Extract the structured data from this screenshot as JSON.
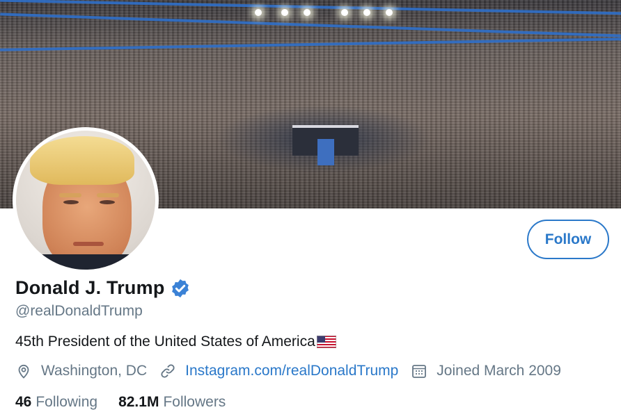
{
  "profile": {
    "name": "Donald J. Trump",
    "handle": "@realDonaldTrump",
    "bio": "45th President of the United States of America",
    "location": "Washington, DC",
    "website": "Instagram.com/realDonaldTrump",
    "joined": "Joined March 2009"
  },
  "actions": {
    "follow_label": "Follow"
  },
  "stats": {
    "following_count": "46",
    "following_label": "Following",
    "followers_count": "82.1M",
    "followers_label": "Followers"
  },
  "icons": {
    "verified": "verified-badge-icon",
    "flag": "us-flag-emoji",
    "location": "location-pin-icon",
    "link": "link-icon",
    "calendar": "calendar-icon"
  },
  "colors": {
    "accent": "#2a78c9",
    "verified": "#3b82d6",
    "text_primary": "#14171a",
    "text_secondary": "#657786"
  }
}
